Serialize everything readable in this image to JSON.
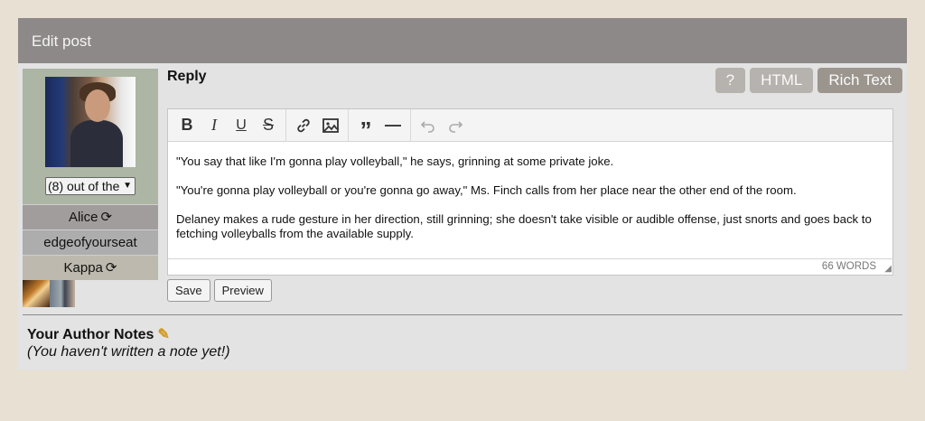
{
  "panel": {
    "title": "Edit post"
  },
  "character": {
    "select_value": "(8) out of the",
    "rows": [
      {
        "label": "Alice",
        "has_refresh": true
      },
      {
        "label": "edgeofyourseat",
        "has_refresh": false
      },
      {
        "label": "Kappa",
        "has_refresh": true
      }
    ]
  },
  "reply": {
    "title": "Reply",
    "modes": [
      {
        "label": "?",
        "active": false
      },
      {
        "label": "HTML",
        "active": false
      },
      {
        "label": "Rich Text",
        "active": true
      }
    ]
  },
  "toolbar": {
    "buttons": [
      {
        "name": "bold-icon",
        "glyph": "B"
      },
      {
        "name": "italic-icon",
        "glyph": "I"
      },
      {
        "name": "underline-icon",
        "glyph": "U"
      },
      {
        "name": "strikethrough-icon",
        "glyph": "S"
      },
      {
        "name": "link-icon",
        "glyph": "link"
      },
      {
        "name": "image-icon",
        "glyph": "image"
      },
      {
        "name": "blockquote-icon",
        "glyph": "”"
      },
      {
        "name": "horizontal-rule-icon",
        "glyph": "—"
      },
      {
        "name": "undo-icon",
        "glyph": "↶"
      },
      {
        "name": "redo-icon",
        "glyph": "↷"
      }
    ]
  },
  "editor": {
    "paragraphs": [
      "\"You say that like I'm gonna play volleyball,\" he says, grinning at some private joke.",
      "\"You're gonna play volleyball or you're gonna go away,\" Ms. Finch calls from her place near the other end of the room.",
      "Delaney makes a rude gesture in her direction, still grinning; she doesn't take visible or audible offense, just snorts and goes back to fetching volleyballs from the available supply."
    ],
    "word_count": "66 WORDS"
  },
  "actions": {
    "save_label": "Save",
    "preview_label": "Preview"
  },
  "notes": {
    "title": "Your Author Notes",
    "placeholder_text": "(You haven't written a note yet!)"
  }
}
